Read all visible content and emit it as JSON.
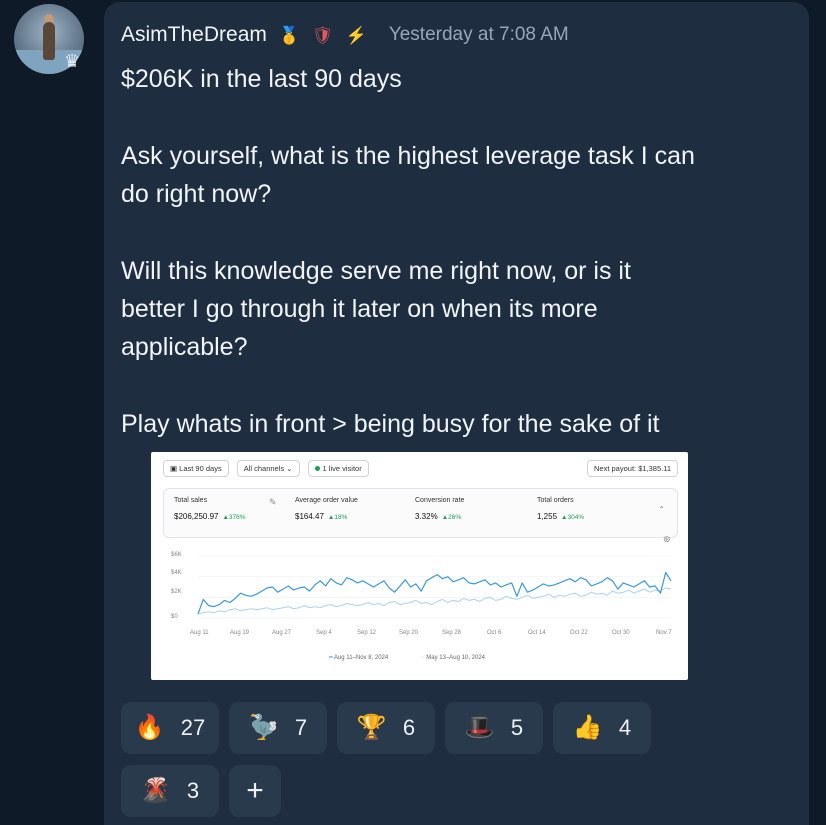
{
  "user": {
    "name": "AsimTheDream",
    "badges": [
      "🥇",
      "🛡",
      "⚡"
    ],
    "timestamp": "Yesterday at 7:08 AM",
    "avatar_badge": "♛"
  },
  "message": {
    "paragraphs": [
      [
        "$206K in the last 90 days"
      ],
      [
        "Ask yourself, what is the highest leverage task I can",
        "do right now?"
      ],
      [
        "Will this knowledge serve me right now, or is it",
        "better I go through it later on when its more",
        "applicable?"
      ],
      [
        "Play whats in front > being busy for the sake of it"
      ]
    ]
  },
  "attachment": {
    "filters": [
      "Last 90 days",
      "All channels",
      "1 live visitor"
    ],
    "payout": "Next payout: $1,385.11",
    "metrics": [
      {
        "label": "Total sales",
        "value": "$206,250.97",
        "change": "▲376%"
      },
      {
        "label": "Average order value",
        "value": "$164.47",
        "change": "▲18%"
      },
      {
        "label": "Conversion rate",
        "value": "3.32%",
        "change": "▲26%"
      },
      {
        "label": "Total orders",
        "value": "1,255",
        "change": "▲304%"
      }
    ],
    "chart_data": {
      "type": "line",
      "y_ticks": [
        "$6K",
        "$4K",
        "$2K",
        "$0"
      ],
      "ylim": [
        0,
        6000
      ],
      "x_ticks": [
        "Aug 11",
        "Aug 19",
        "Aug 27",
        "Sep 4",
        "Sep 12",
        "Sep 20",
        "Sep 28",
        "Oct 6",
        "Oct 14",
        "Oct 22",
        "Oct 30",
        "Nov 7"
      ],
      "series": [
        {
          "name": "Aug 11–Nov 8, 2024",
          "color": "#3b9ad9",
          "values": [
            400,
            1800,
            1200,
            1100,
            1300,
            1700,
            1500,
            1900,
            2400,
            2200,
            2100,
            2300,
            2600,
            2900,
            3000,
            2500,
            2800,
            3100,
            2700,
            2900,
            3000,
            2600,
            3200,
            3600,
            3100,
            3800,
            3400,
            3200,
            3900,
            3700,
            3400,
            3600,
            3300,
            3000,
            3300,
            3600,
            2900,
            2500,
            3100,
            3700,
            3000,
            3300,
            2600,
            3600,
            3900,
            4200,
            3800,
            4000,
            3500,
            3700,
            3900,
            3400,
            3300,
            3500,
            3700,
            3200,
            3400,
            3000,
            3200,
            3400,
            2100,
            3400,
            2500,
            2700,
            3000,
            3300,
            3100,
            3200,
            3400,
            3600,
            3800,
            3500,
            3900,
            3700,
            3100,
            3300,
            3500,
            3900,
            3600,
            2800,
            3400,
            3200,
            3000,
            3300,
            3600,
            3000,
            3100,
            2400,
            4400,
            3600
          ]
        },
        {
          "name": "May 13–Aug 10, 2024",
          "color": "#a9d3ef",
          "values": [
            400,
            500,
            600,
            500,
            700,
            600,
            800,
            900,
            700,
            800,
            900,
            800,
            900,
            1000,
            800,
            900,
            1000,
            1100,
            900,
            1000,
            1200,
            1000,
            1100,
            1000,
            1200,
            1300,
            1100,
            1200,
            1400,
            1300,
            1200,
            1300,
            1500,
            1300,
            1400,
            1200,
            1500,
            1600,
            1300,
            1400,
            1500,
            1700,
            1400,
            1500,
            1300,
            1600,
            1800,
            1500,
            1700,
            1600,
            1900,
            1700,
            1800,
            1600,
            1900,
            2000,
            1700,
            1800,
            2100,
            1900,
            1800,
            2000,
            2200,
            1900,
            2000,
            2100,
            2300,
            2000,
            2200,
            2100,
            2300,
            2400,
            2100,
            2200,
            2500,
            2300,
            2400,
            2200,
            2600,
            2400,
            2500,
            2700,
            2400,
            2600,
            2800,
            2500,
            2700,
            2600,
            2900,
            2800
          ]
        }
      ]
    }
  },
  "reactions": [
    {
      "emoji": "🔥",
      "count": "27"
    },
    {
      "emoji": "🦤",
      "count": "7"
    },
    {
      "emoji": "🏆",
      "count": "6"
    },
    {
      "emoji": "🎩",
      "count": "5"
    },
    {
      "emoji": "👍",
      "count": "4"
    },
    {
      "emoji": "🌋",
      "count": "3"
    }
  ],
  "add_reaction_label": "+"
}
